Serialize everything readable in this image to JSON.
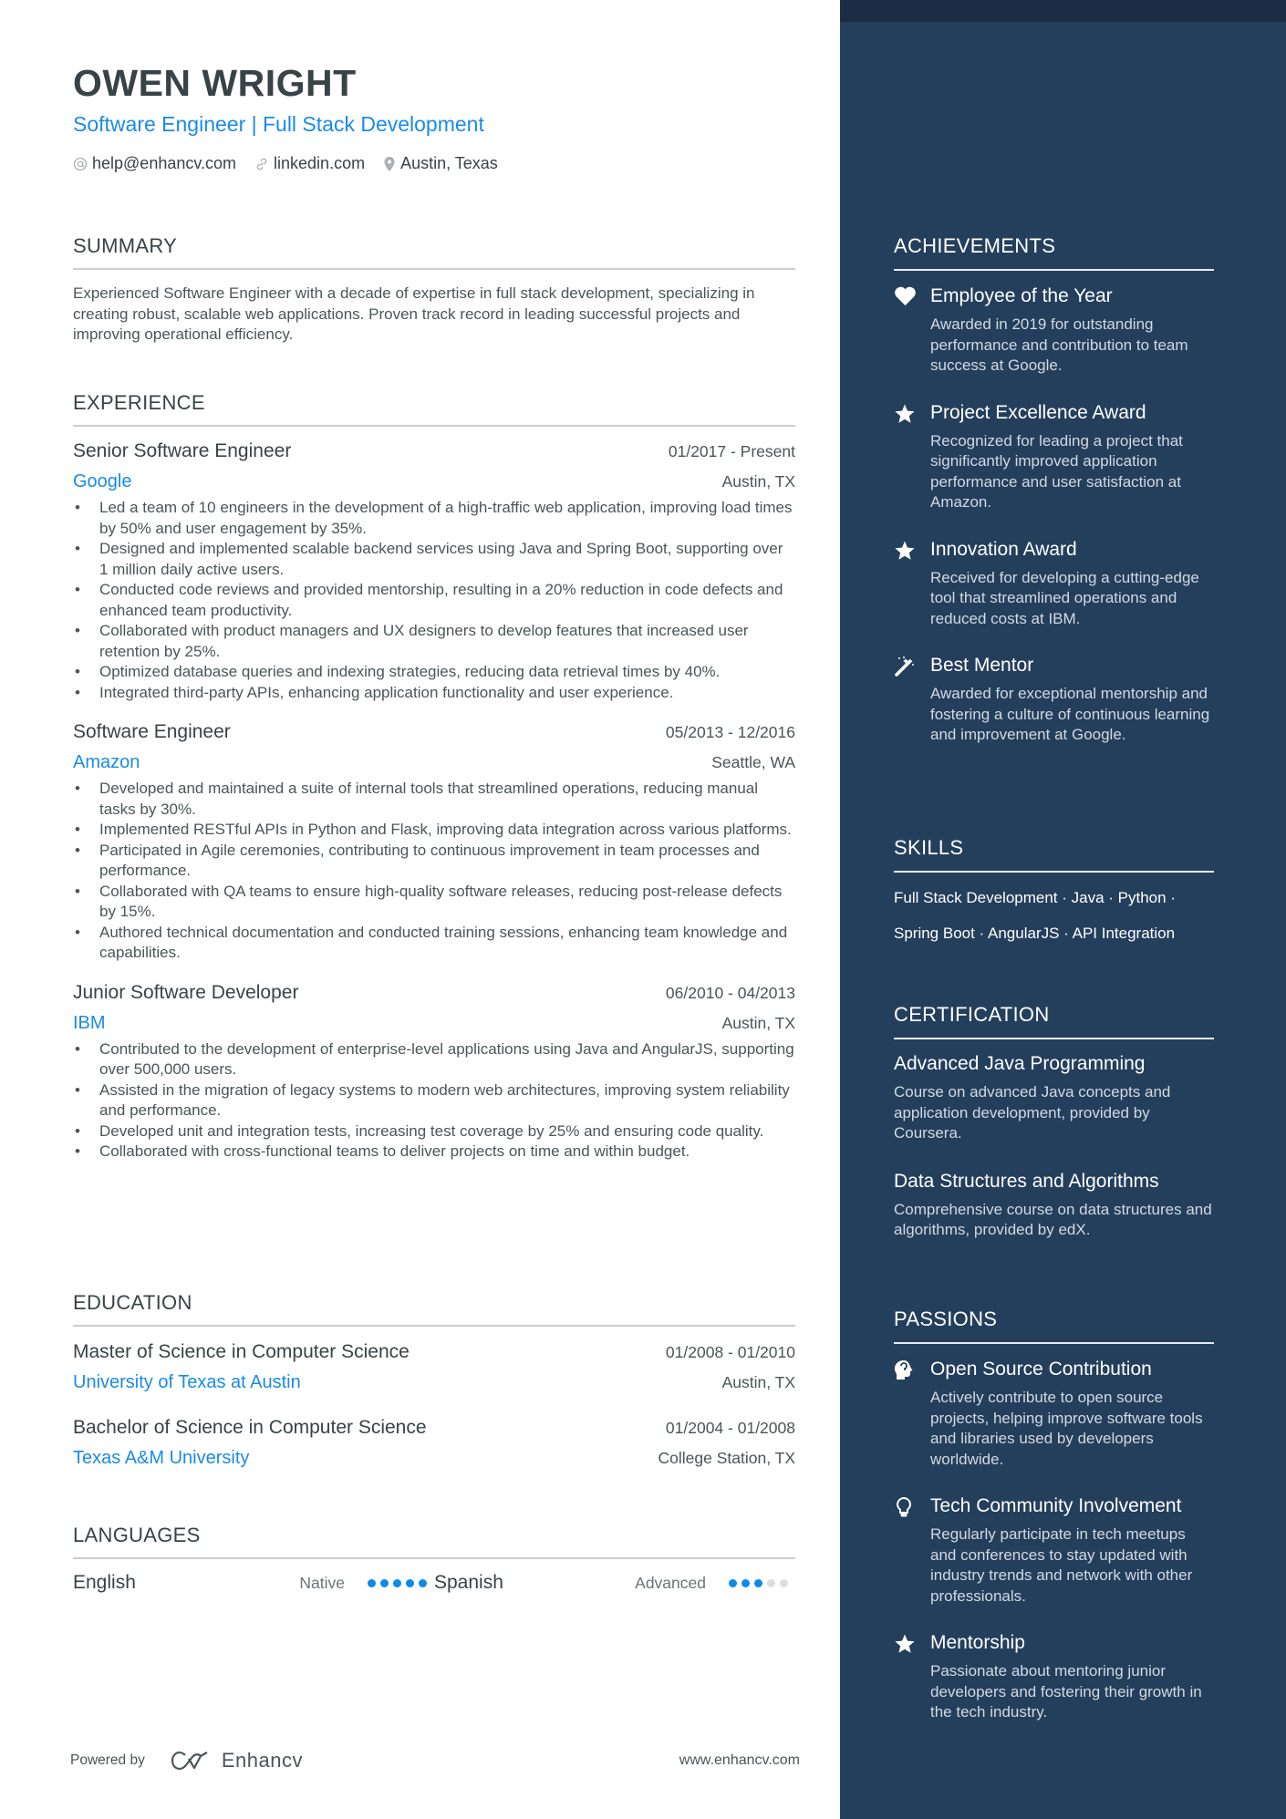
{
  "header": {
    "name": "OWEN WRIGHT",
    "headline": "Software Engineer | Full Stack Development",
    "contacts": [
      {
        "icon": "at-icon",
        "text": "help@enhancv.com"
      },
      {
        "icon": "link-icon",
        "text": "linkedin.com"
      },
      {
        "icon": "location-pin-icon",
        "text": "Austin, Texas"
      }
    ]
  },
  "summary": {
    "title": "SUMMARY",
    "text": "Experienced Software Engineer with a decade of expertise in full stack development, specializing in creating robust, scalable web applications. Proven track record in leading successful projects and improving operational efficiency."
  },
  "experience": {
    "title": "EXPERIENCE",
    "jobs": [
      {
        "title": "Senior Software Engineer",
        "dates": "01/2017 - Present",
        "company": "Google",
        "location": "Austin, TX",
        "bullets": [
          "Led a team of 10 engineers in the development of a high-traffic web application, improving load times by 50% and user engagement by 35%.",
          "Designed and implemented scalable backend services using Java and Spring Boot, supporting over 1 million daily active users.",
          "Conducted code reviews and provided mentorship, resulting in a 20% reduction in code defects and enhanced team productivity.",
          "Collaborated with product managers and UX designers to develop features that increased user retention by 25%.",
          "Optimized database queries and indexing strategies, reducing data retrieval times by 40%.",
          "Integrated third-party APIs, enhancing application functionality and user experience."
        ]
      },
      {
        "title": "Software Engineer",
        "dates": "05/2013 - 12/2016",
        "company": "Amazon",
        "location": "Seattle, WA",
        "bullets": [
          "Developed and maintained a suite of internal tools that streamlined operations, reducing manual tasks by 30%.",
          "Implemented RESTful APIs in Python and Flask, improving data integration across various platforms.",
          "Participated in Agile ceremonies, contributing to continuous improvement in team processes and performance.",
          "Collaborated with QA teams to ensure high-quality software releases, reducing post-release defects by 15%.",
          "Authored technical documentation and conducted training sessions, enhancing team knowledge and capabilities."
        ]
      },
      {
        "title": "Junior Software Developer",
        "dates": "06/2010 - 04/2013",
        "company": "IBM",
        "location": "Austin, TX",
        "bullets": [
          "Contributed to the development of enterprise-level applications using Java and AngularJS, supporting over 500,000 users.",
          "Assisted in the migration of legacy systems to modern web architectures, improving system reliability and performance.",
          "Developed unit and integration tests, increasing test coverage by 25% and ensuring code quality.",
          "Collaborated with cross-functional teams to deliver projects on time and within budget."
        ]
      }
    ]
  },
  "education": {
    "title": "EDUCATION",
    "items": [
      {
        "degree": "Master of Science in Computer Science",
        "dates": "01/2008 - 01/2010",
        "school": "University of Texas at Austin",
        "location": "Austin, TX"
      },
      {
        "degree": "Bachelor of Science in Computer Science",
        "dates": "01/2004 - 01/2008",
        "school": "Texas A&M University",
        "location": "College Station, TX"
      }
    ]
  },
  "languages": {
    "title": "LANGUAGES",
    "items": [
      {
        "name": "English",
        "level": "Native",
        "rating": 5,
        "max": 5
      },
      {
        "name": "Spanish",
        "level": "Advanced",
        "rating": 3,
        "max": 5
      }
    ]
  },
  "footer": {
    "powered_by": "Powered by",
    "brand": "Enhancv",
    "url": "www.enhancv.com"
  },
  "sidebar": {
    "achievements": {
      "title": "ACHIEVEMENTS",
      "items": [
        {
          "icon": "heart-icon",
          "title": "Employee of the Year",
          "desc": "Awarded in 2019 for outstanding performance and contribution to team success at Google."
        },
        {
          "icon": "star-icon",
          "title": "Project Excellence Award",
          "desc": "Recognized for leading a project that significantly improved application performance and user satisfaction at Amazon."
        },
        {
          "icon": "star-icon",
          "title": "Innovation Award",
          "desc": "Received for developing a cutting-edge tool that streamlined operations and reduced costs at IBM."
        },
        {
          "icon": "magic-wand-icon",
          "title": "Best Mentor",
          "desc": "Awarded for exceptional mentorship and fostering a culture of continuous learning and improvement at Google."
        }
      ]
    },
    "skills": {
      "title": "SKILLS",
      "lines": [
        "Full Stack Development · Java · Python ·",
        "Spring Boot · AngularJS · API Integration"
      ]
    },
    "certification": {
      "title": "CERTIFICATION",
      "items": [
        {
          "title": "Advanced Java Programming",
          "desc": "Course on advanced Java concepts and application development, provided by Coursera."
        },
        {
          "title": "Data Structures and Algorithms",
          "desc": "Comprehensive course on data structures and algorithms, provided by edX."
        }
      ]
    },
    "passions": {
      "title": "PASSIONS",
      "items": [
        {
          "icon": "head-brain-icon",
          "title": "Open Source Contribution",
          "desc": "Actively contribute to open source projects, helping improve software tools and libraries used by developers worldwide."
        },
        {
          "icon": "lightbulb-icon",
          "title": "Tech Community Involvement",
          "desc": "Regularly participate in tech meetups and conferences to stay updated with industry trends and network with other professionals."
        },
        {
          "icon": "star-icon",
          "title": "Mentorship",
          "desc": "Passionate about mentoring junior developers and fostering their growth in the tech industry."
        }
      ]
    }
  },
  "colors": {
    "accent": "#1a8be6",
    "sidebar_bg": "#243f5c",
    "sidebar_topbar": "#1b2d44",
    "text": "#384347"
  }
}
